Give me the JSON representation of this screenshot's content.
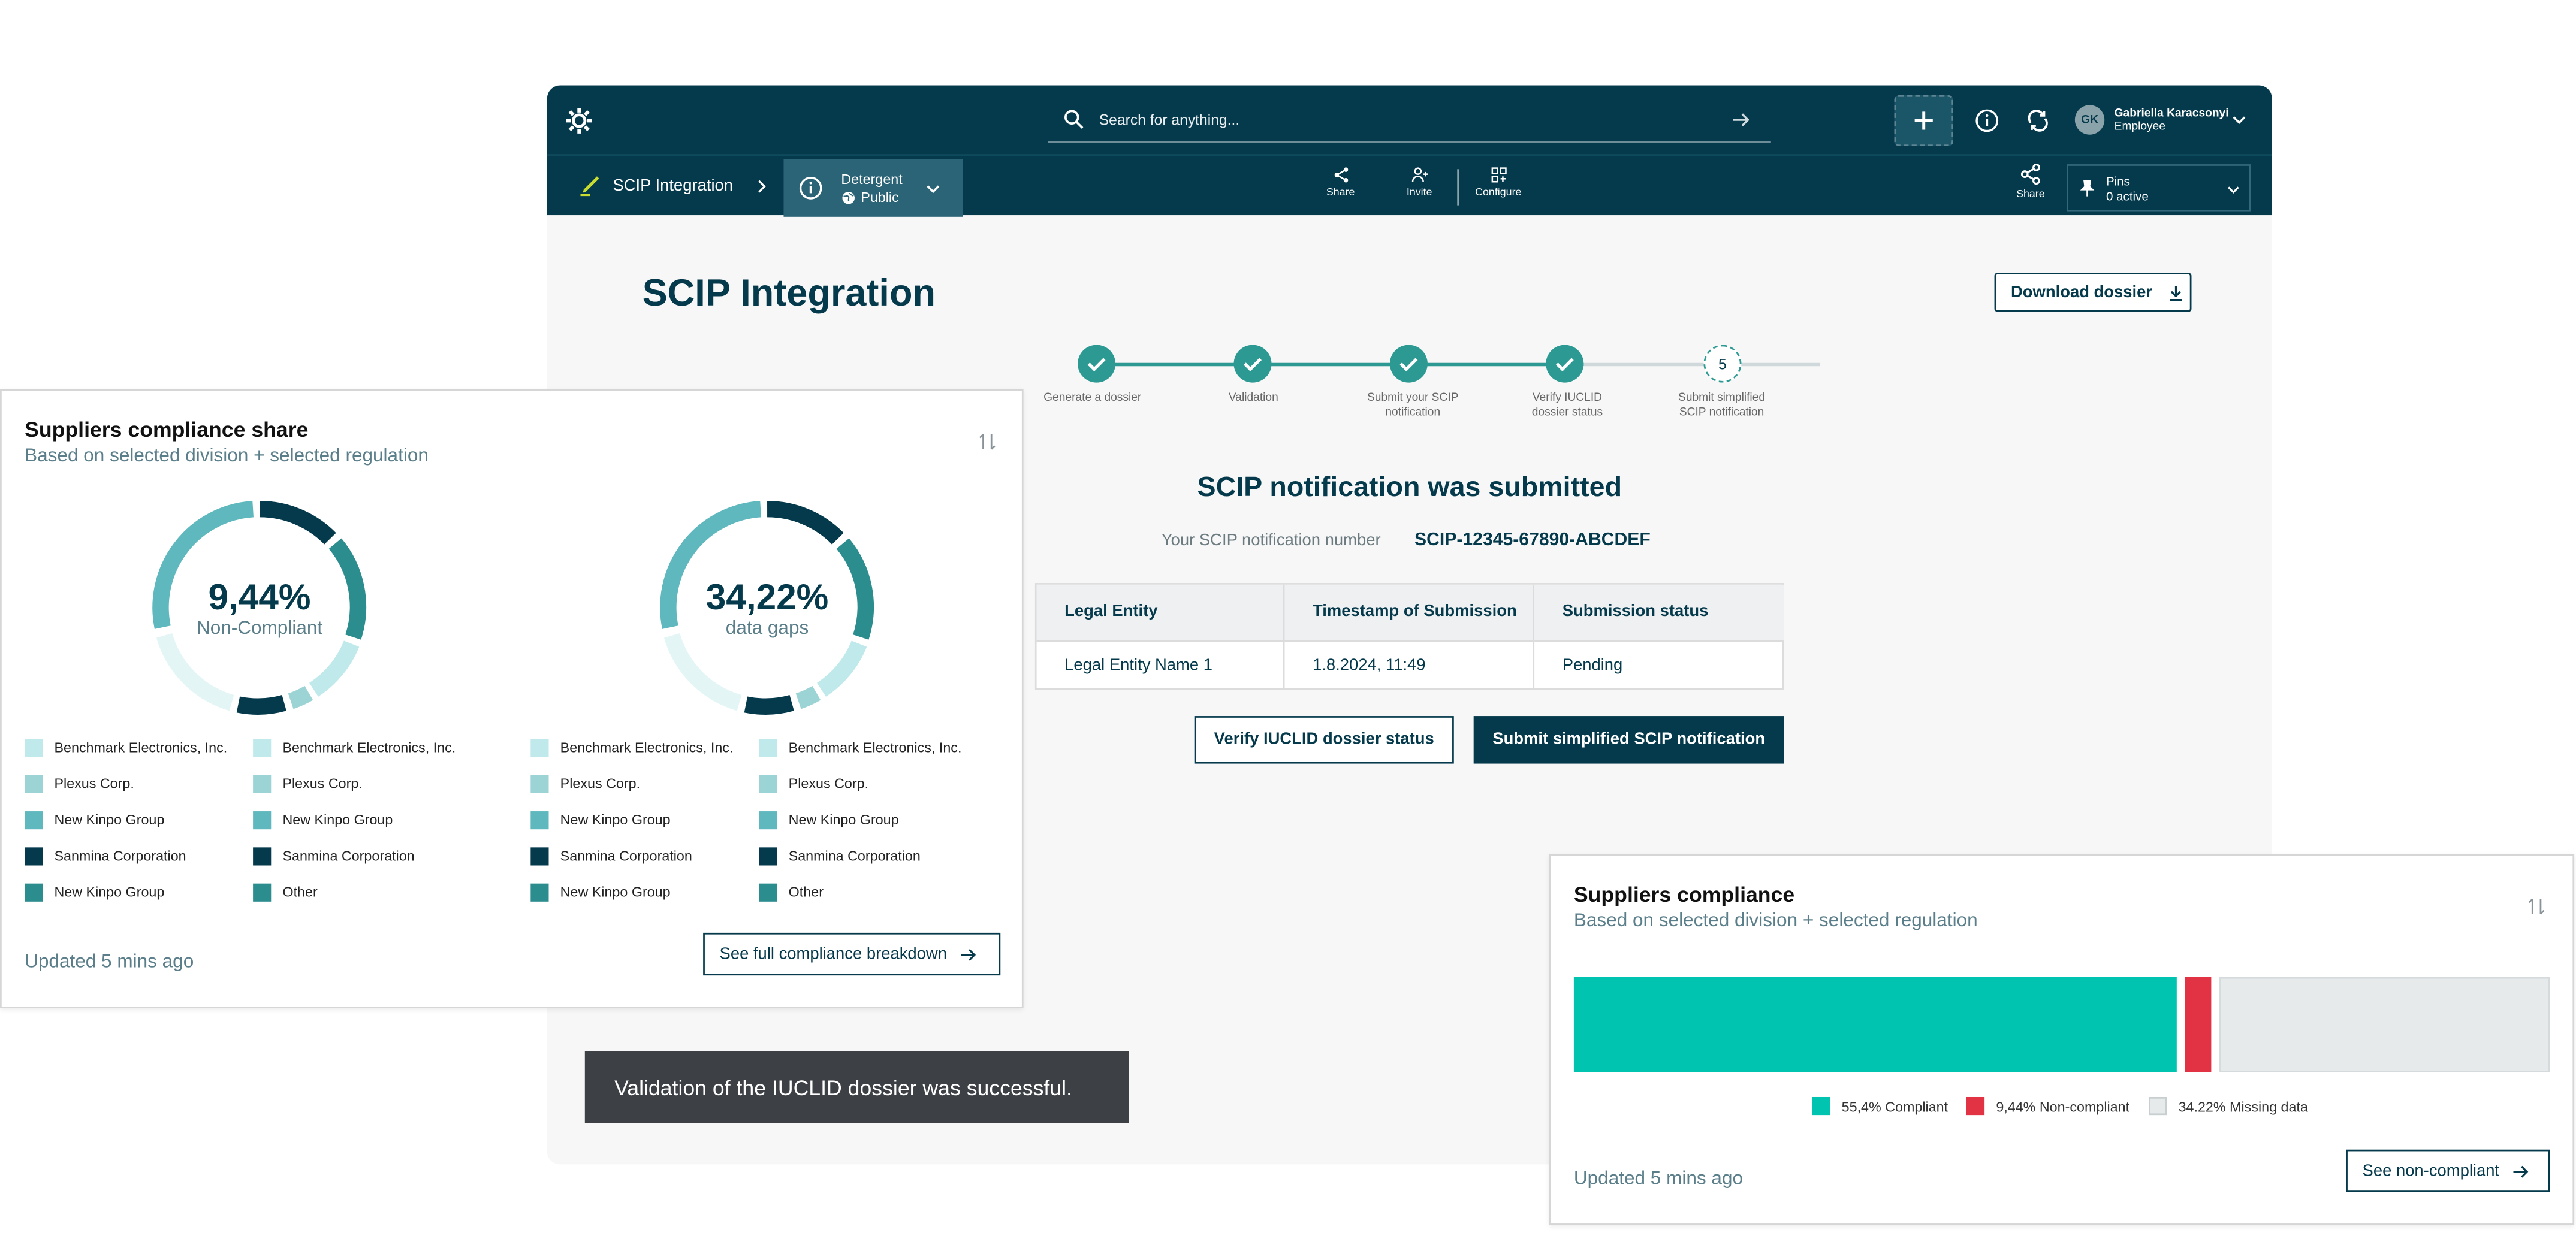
{
  "header": {
    "search_placeholder": "Search for anything...",
    "user_name": "Gabriella Karacsonyi",
    "user_role": "Employee",
    "user_initials": "GK"
  },
  "subbar": {
    "breadcrumb": "SCIP Integration",
    "product_name": "Detergent",
    "product_visibility": "Public",
    "tools": [
      "Share",
      "Invite",
      "Configure"
    ],
    "share_label": "Share",
    "pins_label": "Pins",
    "pins_status": "0 active"
  },
  "main": {
    "page_title": "SCIP Integration",
    "download_label": "Download dossier",
    "steps": [
      {
        "label": "Generate a dossier"
      },
      {
        "label": "Validation"
      },
      {
        "label": "Submit your SCIP notification"
      },
      {
        "label": "Verify IUCLID dossier status"
      },
      {
        "label": "Submit simplified SCIP notification",
        "number": "5"
      }
    ],
    "heading": "SCIP notification was submitted",
    "notification_label": "Your SCIP notification number",
    "notification_number": "SCIP-12345-67890-ABCDEF",
    "table": {
      "headers": [
        "Legal Entity",
        "Timestamp of Submission",
        "Submission status"
      ],
      "row": [
        "Legal Entity Name 1",
        "1.8.2024, 11:49",
        "Pending"
      ]
    },
    "verify_button": "Verify IUCLID dossier status",
    "submit_button": "Submit simplified SCIP notification",
    "toast": "Validation of the IUCLID dossier was successful."
  },
  "card_share": {
    "title": "Suppliers compliance share",
    "subtitle": "Based on selected division + selected regulation",
    "donut1_value": "9,44%",
    "donut1_label": "Non-Compliant",
    "donut2_value": "34,22%",
    "donut2_label": "data gaps",
    "legend_a": [
      {
        "label": "Benchmark Electronics, Inc.",
        "color": "#bfe9ea"
      },
      {
        "label": "Plexus Corp.",
        "color": "#9cd3d5"
      },
      {
        "label": "New Kinpo Group",
        "color": "#5fb8be"
      },
      {
        "label": "Sanmina Corporation",
        "color": "#053a4c"
      },
      {
        "label": "New Kinpo Group",
        "color": "#2c8d8e"
      }
    ],
    "legend_b": [
      {
        "label": "Benchmark Electronics, Inc.",
        "color": "#bfe9ea"
      },
      {
        "label": "Plexus Corp.",
        "color": "#9cd3d5"
      },
      {
        "label": "New Kinpo Group",
        "color": "#5fb8be"
      },
      {
        "label": "Sanmina Corporation",
        "color": "#053a4c"
      },
      {
        "label": "Other",
        "color": "#2c8d8e"
      }
    ],
    "updated": "Updated 5 mins ago",
    "breakdown_button": "See full compliance breakdown"
  },
  "card_compliance": {
    "title": "Suppliers compliance",
    "subtitle": "Based on selected division + selected regulation",
    "bar": [
      {
        "label": "55,4% Compliant",
        "share": 0.628,
        "color": "#00c4b0"
      },
      {
        "label": "9,44% Non-compliant",
        "share": 0.028,
        "color": "#e23344"
      },
      {
        "label": "34.22% Missing data",
        "share": 0.344,
        "color": "#e6eaeb"
      }
    ],
    "updated": "Updated 5 mins ago",
    "button": "See non-compliant"
  }
}
